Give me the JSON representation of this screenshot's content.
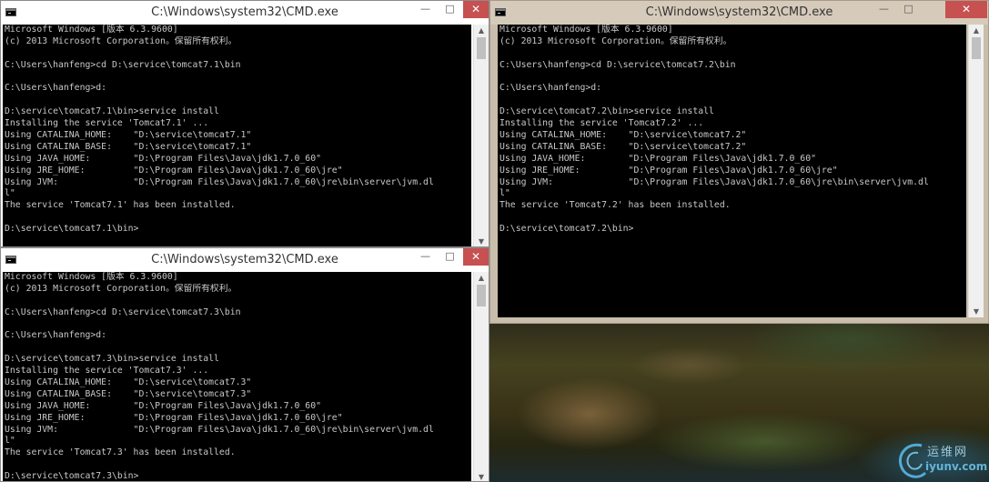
{
  "watermark": {
    "text": "运维网",
    "url": "iyunv.com"
  },
  "controls": {
    "minimize": "—",
    "maximize": "□",
    "close": "✕",
    "scroll_up": "▲",
    "scroll_down": "▼"
  },
  "windows": [
    {
      "title": "C:\\Windows\\system32\\CMD.exe",
      "lines": [
        "Microsoft Windows [版本 6.3.9600]",
        "(c) 2013 Microsoft Corporation。保留所有权利。",
        "",
        "C:\\Users\\hanfeng>cd D:\\service\\tomcat7.1\\bin",
        "",
        "C:\\Users\\hanfeng>d:",
        "",
        "D:\\service\\tomcat7.1\\bin>service install",
        "Installing the service 'Tomcat7.1' ...",
        "Using CATALINA_HOME:    \"D:\\service\\tomcat7.1\"",
        "Using CATALINA_BASE:    \"D:\\service\\tomcat7.1\"",
        "Using JAVA_HOME:        \"D:\\Program Files\\Java\\jdk1.7.0_60\"",
        "Using JRE_HOME:         \"D:\\Program Files\\Java\\jdk1.7.0_60\\jre\"",
        "Using JVM:              \"D:\\Program Files\\Java\\jdk1.7.0_60\\jre\\bin\\server\\jvm.dl",
        "l\"",
        "The service 'Tomcat7.1' has been installed.",
        "",
        "D:\\service\\tomcat7.1\\bin>"
      ]
    },
    {
      "title": "C:\\Windows\\system32\\CMD.exe",
      "lines": [
        "Microsoft Windows [版本 6.3.9600]",
        "(c) 2013 Microsoft Corporation。保留所有权利。",
        "",
        "C:\\Users\\hanfeng>cd D:\\service\\tomcat7.2\\bin",
        "",
        "C:\\Users\\hanfeng>d:",
        "",
        "D:\\service\\tomcat7.2\\bin>service install",
        "Installing the service 'Tomcat7.2' ...",
        "Using CATALINA_HOME:    \"D:\\service\\tomcat7.2\"",
        "Using CATALINA_BASE:    \"D:\\service\\tomcat7.2\"",
        "Using JAVA_HOME:        \"D:\\Program Files\\Java\\jdk1.7.0_60\"",
        "Using JRE_HOME:         \"D:\\Program Files\\Java\\jdk1.7.0_60\\jre\"",
        "Using JVM:              \"D:\\Program Files\\Java\\jdk1.7.0_60\\jre\\bin\\server\\jvm.dl",
        "l\"",
        "The service 'Tomcat7.2' has been installed.",
        "",
        "D:\\service\\tomcat7.2\\bin>"
      ]
    },
    {
      "title": "C:\\Windows\\system32\\CMD.exe",
      "lines": [
        "Microsoft Windows [版本 6.3.9600]",
        "(c) 2013 Microsoft Corporation。保留所有权利。",
        "",
        "C:\\Users\\hanfeng>cd D:\\service\\tomcat7.3\\bin",
        "",
        "C:\\Users\\hanfeng>d:",
        "",
        "D:\\service\\tomcat7.3\\bin>service install",
        "Installing the service 'Tomcat7.3' ...",
        "Using CATALINA_HOME:    \"D:\\service\\tomcat7.3\"",
        "Using CATALINA_BASE:    \"D:\\service\\tomcat7.3\"",
        "Using JAVA_HOME:        \"D:\\Program Files\\Java\\jdk1.7.0_60\"",
        "Using JRE_HOME:         \"D:\\Program Files\\Java\\jdk1.7.0_60\\jre\"",
        "Using JVM:              \"D:\\Program Files\\Java\\jdk1.7.0_60\\jre\\bin\\server\\jvm.dl",
        "l\"",
        "The service 'Tomcat7.3' has been installed.",
        "",
        "D:\\service\\tomcat7.3\\bin>"
      ]
    }
  ]
}
